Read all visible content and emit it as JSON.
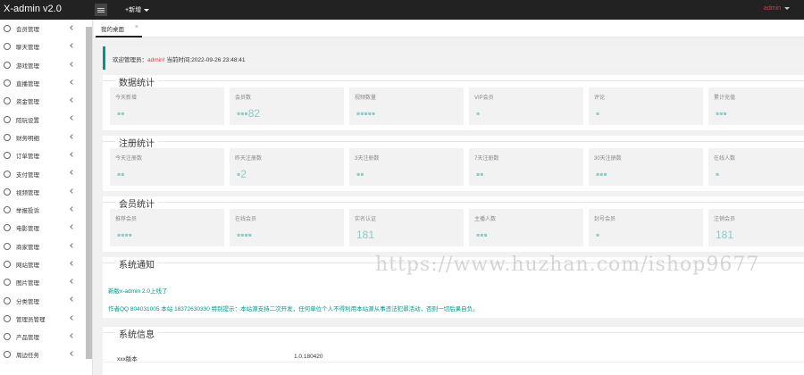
{
  "header": {
    "logo": "X-admin v2.0",
    "new_label": "+新增",
    "user": "admin"
  },
  "sidebar": {
    "items": [
      {
        "label": "会员管理",
        "icon": "user-icon"
      },
      {
        "label": "聊天管理",
        "icon": "user-icon"
      },
      {
        "label": "游戏管理",
        "icon": "user-icon"
      },
      {
        "label": "直播管理",
        "icon": "circle-icon"
      },
      {
        "label": "资金管理",
        "icon": "circle-icon"
      },
      {
        "label": "陪玩设置",
        "icon": "circle-icon"
      },
      {
        "label": "财务明细",
        "icon": "circle-icon"
      },
      {
        "label": "订单管理",
        "icon": "circle-icon"
      },
      {
        "label": "支付管理",
        "icon": "circle-icon"
      },
      {
        "label": "视频管理",
        "icon": "circle-icon"
      },
      {
        "label": "举报投诉",
        "icon": "circle-icon"
      },
      {
        "label": "电影管理",
        "icon": "circle-icon"
      },
      {
        "label": "商家管理",
        "icon": "circle-icon"
      },
      {
        "label": "网站管理",
        "icon": "circle-icon"
      },
      {
        "label": "图片管理",
        "icon": "circle-icon"
      },
      {
        "label": "分类管理",
        "icon": "circle-icon"
      },
      {
        "label": "管理员管理",
        "icon": "user-icon"
      },
      {
        "label": "产品管理",
        "icon": "circle-icon"
      },
      {
        "label": "周边任务",
        "icon": "circle-icon"
      }
    ]
  },
  "tabs": [
    {
      "label": "我的桌面"
    }
  ],
  "welcome": {
    "prefix": "欢迎管理员：",
    "user": "admin!",
    "time_label": "当前时间:",
    "time": "2022-09-26 23:48:41"
  },
  "data_stats": {
    "title": "数据统计",
    "cards": [
      {
        "label": "今天新增",
        "value": "▪▪"
      },
      {
        "label": "会员数",
        "value": "▪▪▪82"
      },
      {
        "label": "视频数量",
        "value": "▪▪▪▪▪"
      },
      {
        "label": "VIP会员",
        "value": "▪"
      },
      {
        "label": "评论",
        "value": "▪"
      },
      {
        "label": "累计充值",
        "value": "▪▪▪"
      }
    ]
  },
  "register_stats": {
    "title": "注册统计",
    "cards": [
      {
        "label": "今天注册数",
        "value": "▪▪"
      },
      {
        "label": "昨天注册数",
        "value": "▪2"
      },
      {
        "label": "3天注册数",
        "value": "▪▪"
      },
      {
        "label": "7天注册数",
        "value": "▪▪"
      },
      {
        "label": "30天注册数",
        "value": "▪▪▪"
      },
      {
        "label": "在线人数",
        "value": "▪"
      }
    ]
  },
  "member_stats": {
    "title": "会员统计",
    "cards": [
      {
        "label": "推荐会员",
        "value": "▪▪▪▪"
      },
      {
        "label": "在线会员",
        "value": "▪▪▪▪"
      },
      {
        "label": "实名认证",
        "value": "181"
      },
      {
        "label": "主播人数",
        "value": "▪▪▪"
      },
      {
        "label": "封号会员",
        "value": "▪"
      },
      {
        "label": "注销会员",
        "value": "181"
      }
    ]
  },
  "notice": {
    "title": "系统通知",
    "lines": [
      "新版x-admin 2.0上线了",
      "作者QQ 804031005 本站 18372630330 特别提示：本站源支持二次开发，任何单位个人不得利用本站源从事违法犯罪活动，否则一切后果自负。"
    ]
  },
  "system_info": {
    "title": "系统信息",
    "rows": [
      {
        "key": "xxx版本",
        "value": "1.0.180420"
      }
    ]
  },
  "watermark": "https://www.huzhan.com/ishop9677"
}
